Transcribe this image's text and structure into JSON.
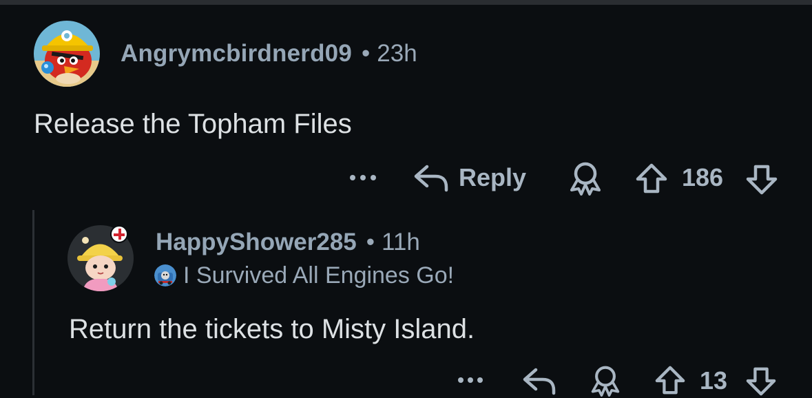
{
  "comments": [
    {
      "username": "Angrymcbirdnerd09",
      "separator": "•",
      "age": "23h",
      "body": "Release the Topham Files",
      "avatar_icon": "angry-bird-miner-avatar",
      "actions": {
        "more_icon": "•••",
        "reply_label": "Reply",
        "score": "186"
      }
    },
    {
      "username": "HappyShower285",
      "separator": "•",
      "age": "11h",
      "flair": "I Survived All Engines Go!",
      "flair_icon": "train-engine-icon",
      "body": "Return the tickets to Misty Island.",
      "avatar_icon": "bucket-hat-avatar",
      "badge_icon": "england-flag-icon",
      "actions": {
        "more_icon": "•••",
        "score": "13"
      }
    }
  ],
  "colors": {
    "background": "#0b0e11",
    "meta_text": "#9aa9b8",
    "body_text": "#dde1e4",
    "action_text": "#a9b6c3",
    "thread_line": "#2c3035"
  }
}
